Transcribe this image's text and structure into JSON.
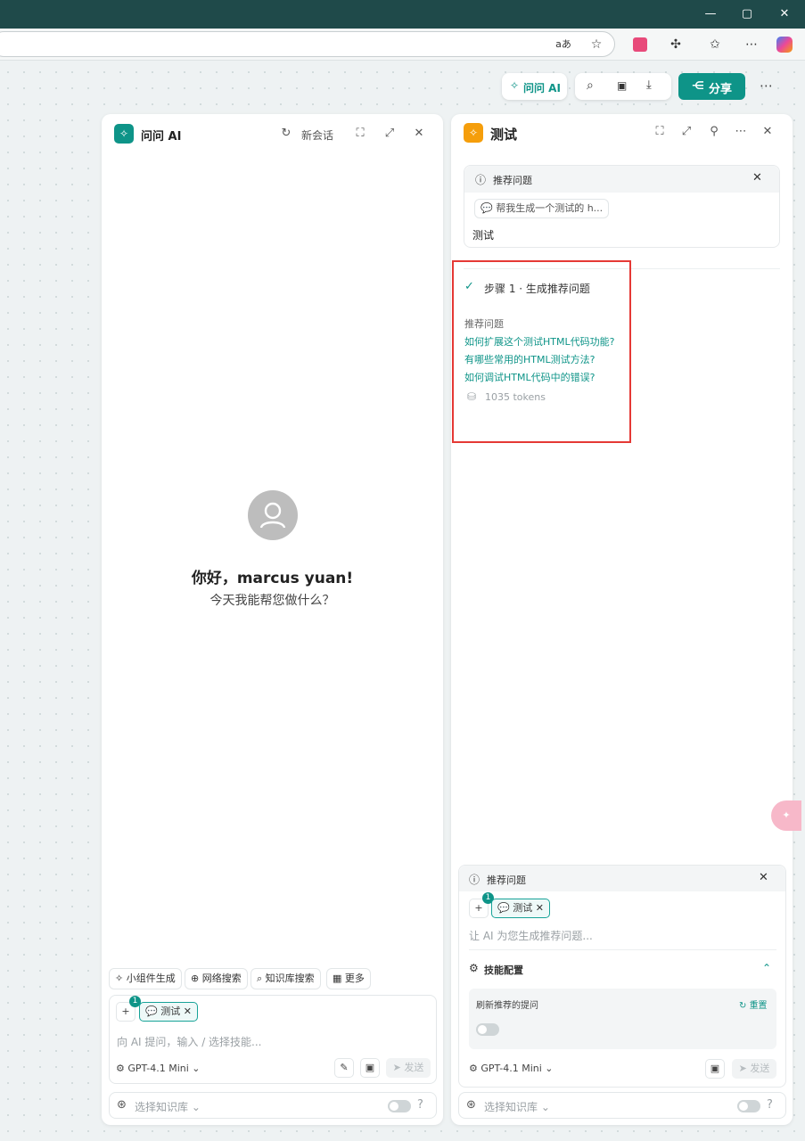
{
  "browser": {
    "window_controls": [
      "—",
      "▢",
      "✕"
    ],
    "toolbar_icons": [
      "read-aloud-icon",
      "favorite-star-icon",
      "translate-icon",
      "extensions-icon",
      "favorites-icon",
      "more-icon",
      "copilot-icon"
    ],
    "read_aloud_label": "aあ"
  },
  "canvas_toolbar": {
    "ask_ai_label": "问问 AI",
    "share_label": "分享"
  },
  "left_panel": {
    "title": "问问 AI",
    "new_chat_label": "新会话",
    "greeting": "你好，marcus yuan!",
    "subtitle": "今天我能帮您做什么？",
    "skills": [
      {
        "label": "小组件生成"
      },
      {
        "label": "网络搜索"
      },
      {
        "label": "知识库搜索"
      },
      {
        "label": "更多"
      }
    ],
    "context_count": "1",
    "context_tag": "测试",
    "input_placeholder": "向 AI 提问，输入 / 选择技能...",
    "model": "GPT-4.1 Mini",
    "send_label": "发送",
    "kb_label": "选择知识库"
  },
  "right_panel": {
    "title": "测试",
    "card": {
      "header": "推荐问题",
      "query_chip": "帮我生成一个测试的 h...",
      "text": "测试"
    },
    "step": {
      "title": "步骤 1 · 生成推荐问题",
      "section_label": "推荐问题",
      "questions": [
        "如何扩展这个测试HTML代码功能?",
        "有哪些常用的HTML测试方法?",
        "如何调试HTML代码中的错误?"
      ],
      "tokens": "1035 tokens"
    },
    "composer": {
      "header": "推荐问题",
      "context_count": "1",
      "context_tag": "测试",
      "input_placeholder": "让 AI 为您生成推荐问题...",
      "skill_config_label": "技能配置",
      "refresh_label": "刷新推荐的提问",
      "reset_label": "重置",
      "model": "GPT-4.1 Mini",
      "send_label": "发送",
      "kb_label": "选择知识库"
    }
  },
  "colors": {
    "accent": "#0e9488",
    "titlebar": "#1f4a4a",
    "highlight_box": "#e53935",
    "doc_icon": "#f59e0b"
  }
}
